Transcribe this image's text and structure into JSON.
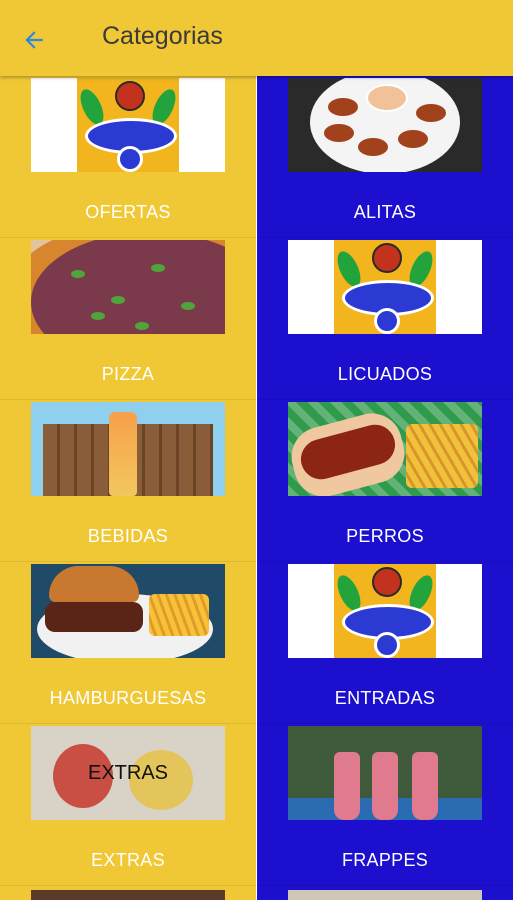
{
  "appbar": {
    "title": "Categorias",
    "back_icon": "arrow-back-icon"
  },
  "colors": {
    "accent_yellow": "#f0c835",
    "accent_blue": "#1d0fce",
    "back_arrow": "#2a86e0"
  },
  "categories": [
    {
      "label": "OFERTAS",
      "image": "logo"
    },
    {
      "label": "ALITAS",
      "image": "wings"
    },
    {
      "label": "PIZZA",
      "image": "pizza"
    },
    {
      "label": "LICUADOS",
      "image": "logo"
    },
    {
      "label": "BEBIDAS",
      "image": "drink"
    },
    {
      "label": "PERROS",
      "image": "hotdog"
    },
    {
      "label": "HAMBURGUESAS",
      "image": "burger"
    },
    {
      "label": "ENTRADAS",
      "image": "logo"
    },
    {
      "label": "EXTRAS",
      "image": "extras",
      "overlay_text": "EXTRAS"
    },
    {
      "label": "FRAPPES",
      "image": "frappe"
    }
  ]
}
